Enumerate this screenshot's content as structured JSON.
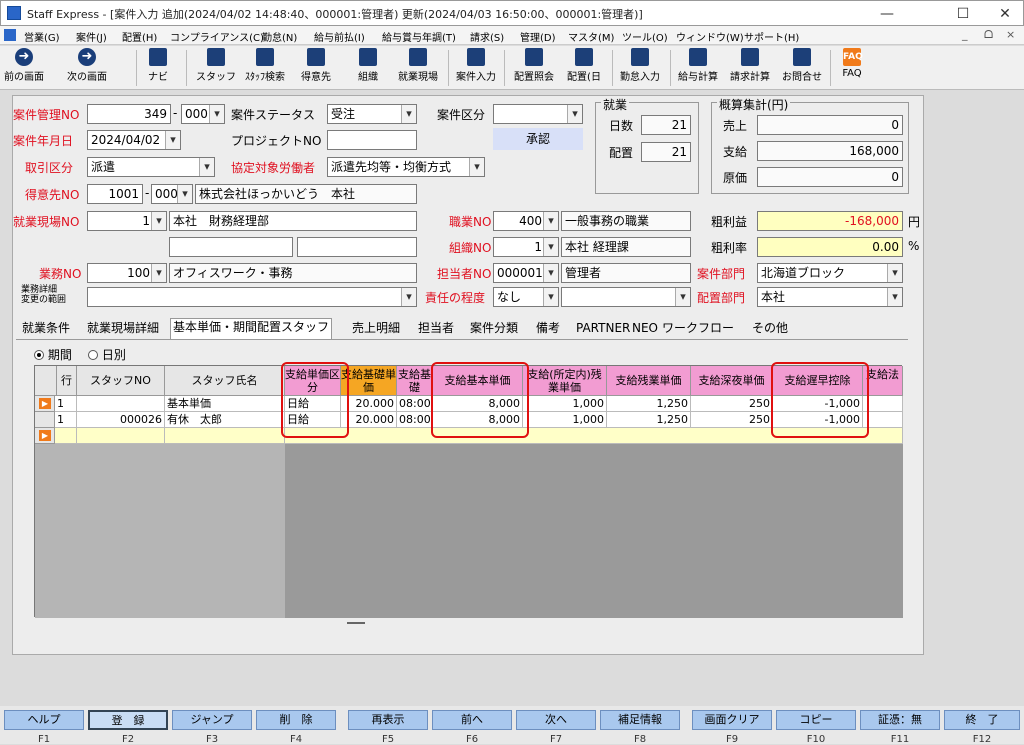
{
  "window": {
    "title": "Staff Express - [案件入力 追加(2024/04/02 14:48:40、000001:管理者) 更新(2024/04/03 16:50:00、000001:管理者)]",
    "minimize": "—",
    "maximize": "☐",
    "close": "✕"
  },
  "menu": [
    "営業(G)",
    "案件(J)",
    "配置(H)",
    "コンプライアンス(C)",
    "勤怠(N)",
    "給与前払(I)",
    "給与賞与年調(T)",
    "請求(S)",
    "管理(D)",
    "マスタ(M)",
    "ツール(O)",
    "ウィンドウ(W)",
    "サポート(H)"
  ],
  "mdi_controls": [
    "_",
    "ᗝ",
    "×"
  ],
  "toolbar": [
    {
      "label": "前の画面",
      "icon": "left-arrow-icon"
    },
    {
      "label": "次の画面",
      "icon": "right-arrow-icon"
    },
    {
      "label": "ナビ",
      "icon": "navi-icon"
    },
    {
      "label": "スタッフ",
      "icon": "staff-icon"
    },
    {
      "label": "ｽﾀｯﾌ検索",
      "icon": "staff-search-icon"
    },
    {
      "label": "得意先",
      "icon": "customer-icon"
    },
    {
      "label": "組織",
      "icon": "organization-icon"
    },
    {
      "label": "就業現場",
      "icon": "workplace-icon"
    },
    {
      "label": "案件入力",
      "icon": "case-entry-icon"
    },
    {
      "label": "配置照会",
      "icon": "assignment-inquiry-icon"
    },
    {
      "label": "配置(日",
      "icon": "assignment-daily-icon"
    },
    {
      "label": "勤怠入力",
      "icon": "attendance-entry-icon"
    },
    {
      "label": "給与計算",
      "icon": "payroll-icon"
    },
    {
      "label": "請求計算",
      "icon": "billing-icon"
    },
    {
      "label": "お問合せ",
      "icon": "inquiry-icon"
    },
    {
      "label": "FAQ",
      "icon": "faq-icon",
      "badge": "FAQ"
    }
  ],
  "form": {
    "case_no_label": "案件管理NO",
    "case_no": "349",
    "case_no_sub": "000",
    "status_label": "案件ステータス",
    "status": "受注",
    "category_label": "案件区分",
    "category": "",
    "date_label": "案件年月日",
    "date": "2024/04/02",
    "project_label": "プロジェクトNO",
    "project": "",
    "approve_label": "承認",
    "trade_label": "取引区分",
    "trade": "派遣",
    "agreement_label": "協定対象労働者",
    "agreement": "派遣先均等・均衡方式",
    "customer_label": "得意先NO",
    "customer_no": "1001",
    "customer_sub": "000",
    "customer_name": "株式会社ほっかいどう　本社",
    "workplace_label": "就業現場NO",
    "workplace_no": "1",
    "workplace_name": "本社　財務経理部",
    "job_label": "職業NO",
    "job_no": "400",
    "job_name": "一般事務の職業",
    "org_label": "組織NO",
    "org_no": "1",
    "org_name": "本社 経理課",
    "duty_label": "業務NO",
    "duty_no": "100",
    "duty_name": "オフィスワーク・事務",
    "person_label": "担当者NO",
    "person_no": "000001",
    "person_name": "管理者",
    "dept_label": "案件部門",
    "dept": "北海道ブロック",
    "duty_detail_label1": "業務詳細",
    "duty_detail_label2": "変更の範囲",
    "responsibility_label": "責任の程度",
    "responsibility": "なし",
    "assign_dept_label": "配置部門",
    "assign_dept": "本社"
  },
  "work": {
    "title": "就業",
    "days_label": "日数",
    "days": "21",
    "assign_label": "配置",
    "assign": "21"
  },
  "summary": {
    "title": "概算集計(円)",
    "sales_label": "売上",
    "sales": "0",
    "pay_label": "支給",
    "pay": "168,000",
    "cost_label": "原価",
    "cost": "0",
    "profit_label": "粗利益",
    "profit": "-168,000",
    "profit_unit": "円",
    "rate_label": "粗利率",
    "rate": "0.00",
    "rate_unit": "%"
  },
  "tabs": [
    "就業条件",
    "就業現場詳細",
    "基本単価・期間配置スタッフ",
    "売上明細",
    "担当者",
    "案件分類",
    "備考",
    "PARTNER",
    "NEO",
    "ワークフロー",
    "その他"
  ],
  "mode": {
    "period": "期間",
    "daily": "日別"
  },
  "grid": {
    "headers": [
      "行",
      "スタッフNO",
      "スタッフ氏名",
      "支給単価区分",
      "支給基礎単価",
      "支給基礎",
      "支給基本単価",
      "支給(所定内)残業単価",
      "支給残業単価",
      "支給深夜単価",
      "支給遅早控除",
      "支給法"
    ],
    "rows": [
      {
        "row": "1",
        "staff_no": "",
        "staff_name": "基本単価",
        "pay_type": "日給",
        "base_price": "20.000",
        "base_time": "08:00",
        "basic": "8,000",
        "ot_in": "1,000",
        "ot": "1,250",
        "night": "250",
        "late": "-1,000"
      },
      {
        "row": "1",
        "staff_no": "000026",
        "staff_name": "有休　太郎",
        "pay_type": "日給",
        "base_price": "20.000",
        "base_time": "08:00",
        "basic": "8,000",
        "ot_in": "1,000",
        "ot": "1,250",
        "night": "250",
        "late": "-1,000"
      }
    ]
  },
  "fkeys": [
    {
      "label": "ヘルプ",
      "key": "F1"
    },
    {
      "label": "登　録",
      "key": "F2"
    },
    {
      "label": "ジャンプ",
      "key": "F3"
    },
    {
      "label": "削　除",
      "key": "F4"
    },
    {
      "label": "再表示",
      "key": "F5"
    },
    {
      "label": "前へ",
      "key": "F6"
    },
    {
      "label": "次へ",
      "key": "F7"
    },
    {
      "label": "補足情報",
      "key": "F8"
    },
    {
      "label": "画面クリア",
      "key": "F9"
    },
    {
      "label": "コピー",
      "key": "F10"
    },
    {
      "label": "証憑：無",
      "key": "F11"
    },
    {
      "label": "終　了",
      "key": "F12"
    }
  ]
}
